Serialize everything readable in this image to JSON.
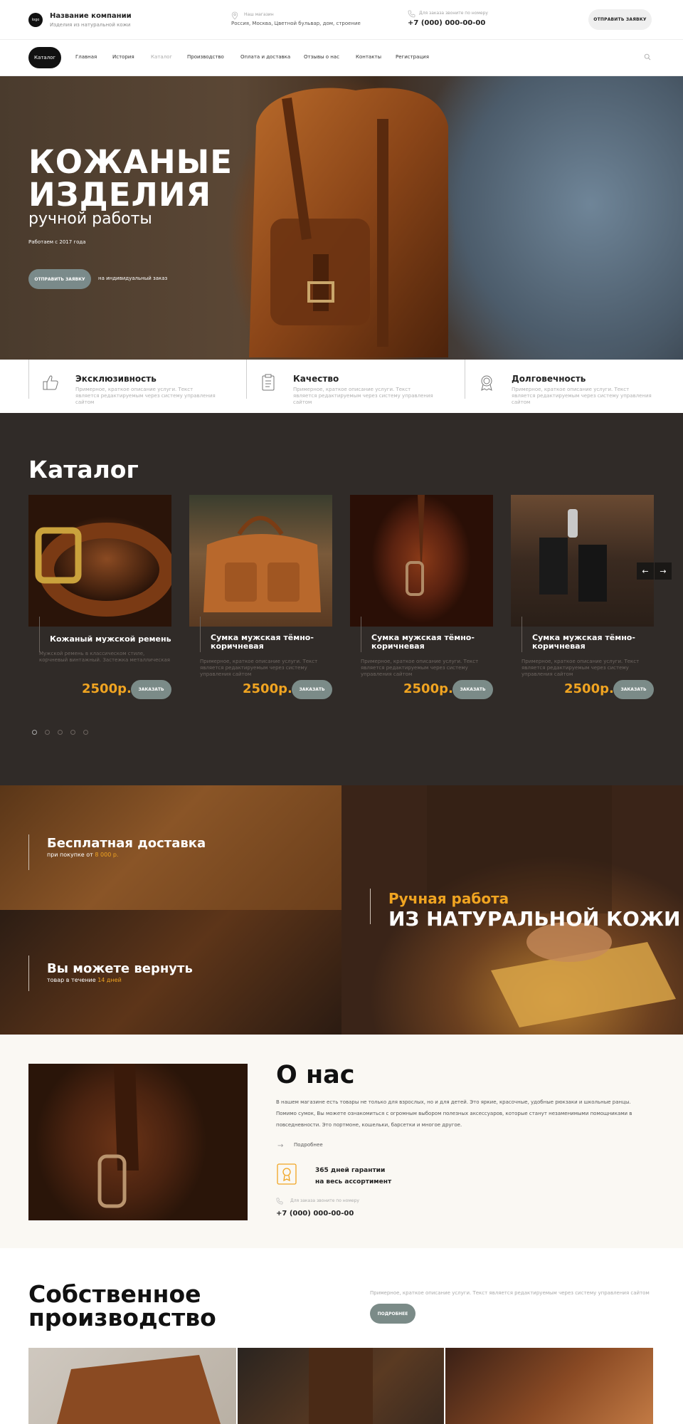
{
  "header": {
    "logo": "logo",
    "company_name": "Название компании",
    "company_sub": "Изделия из натуральной кожи",
    "address_label": "Наш магазин",
    "address": "Россия, Москва, Цветной бульвар, дом, строение",
    "phone_label": "Для заказа звоните по номеру",
    "phone": "+7 (000) 000-00-00",
    "request_button": "ОТПРАВИТЬ ЗАЯВКУ"
  },
  "nav": {
    "items": [
      "Каталог",
      "Главная",
      "История",
      "Каталог",
      "Производство",
      "Оплата и доставка",
      "Отзывы о нас",
      "Контакты",
      "Регистрация"
    ]
  },
  "hero": {
    "title_line1": "КОЖАНЫЕ",
    "title_line2": "ИЗДЕЛИЯ",
    "subtitle": "ручной работы",
    "since": "Работаем с 2017 года",
    "button": "ОТПРАВИТЬ ЗАЯВКУ",
    "note": "на индивидуальный заказ"
  },
  "features": [
    {
      "title": "Эксклюзивность",
      "text": "Примерное, краткое описание услуги. Текст является редактируемым через систему управления сайтом",
      "icon": "thumbs-up-icon"
    },
    {
      "title": "Качество",
      "text": "Примерное, краткое описание услуги. Текст является редактируемым через систему управления сайтом",
      "icon": "clipboard-icon"
    },
    {
      "title": "Долговечность",
      "text": "Примерное, краткое описание услуги. Текст является редактируемым через систему управления сайтом",
      "icon": "award-icon"
    }
  ],
  "catalog": {
    "title": "Каталог",
    "products": [
      {
        "name": "Кожаный мужской ремень",
        "desc": "Мужской ремень в классическом стиле, корчневый винтажный. Застежка металлическая",
        "price": "2500р.",
        "button": "ЗАКАЗАТЬ"
      },
      {
        "name": "Сумка мужская тёмно-коричневая",
        "desc": "Примерное, краткое описание услуги. Текст является редактируемым через систему управления сайтом",
        "price": "2500р.",
        "button": "ЗАКАЗАТЬ"
      },
      {
        "name": "Сумка мужская тёмно-коричневая",
        "desc": "Примерное, краткое описание услуги. Текст является редактируемым через систему управления сайтом",
        "price": "2500р.",
        "button": "ЗАКАЗАТЬ"
      },
      {
        "name": "Сумка мужская тёмно-коричневая",
        "desc": "Примерное, краткое описание услуги. Текст является редактируемым через систему управления сайтом",
        "price": "2500р.",
        "button": "ЗАКАЗАТЬ"
      }
    ],
    "prev_arrow": "←",
    "next_arrow": "→"
  },
  "promo": {
    "delivery_title": "Бесплатная доставка",
    "delivery_sub_prefix": "при покупке от ",
    "delivery_sub_value": "8 000 р.",
    "return_title": "Вы можете вернуть",
    "return_sub_prefix": "товар в течение ",
    "return_sub_value": "14 дней",
    "handmade_gold": "Ручная работа",
    "handmade_big": "ИЗ НАТУРАЛЬНОЙ КОЖИ"
  },
  "about": {
    "title": "О нас",
    "text": "В нашем магазине есть товары не только для взрослых, но и для детей. Это яркие, красочные, удобные рюкзаки и школьные ранцы. Помимо сумок, Вы можете ознакомиться с огромным выбором полезных аксессуаров, которые станут незаменимыми помощниками в повседневности. Это портмоне, кошельки, барсетки и многое другое.",
    "more": "Подробнее",
    "warranty_line1": "365 дней гарантии",
    "warranty_line2": "на весь ассортимент",
    "phone_label": "Для заказа звоните по номеру",
    "phone": "+7 (000) 000-00-00"
  },
  "production": {
    "title_line1": "Собственное",
    "title_line2": "производство",
    "text": "Примерное, краткое описание услуги. Текст является редактируемым через систему управления сайтом",
    "button": "ПОДРОБНЕЕ"
  },
  "colors": {
    "accent": "#f0a421",
    "dark_bg": "#302b28",
    "button_gray": "#7b8b88"
  }
}
